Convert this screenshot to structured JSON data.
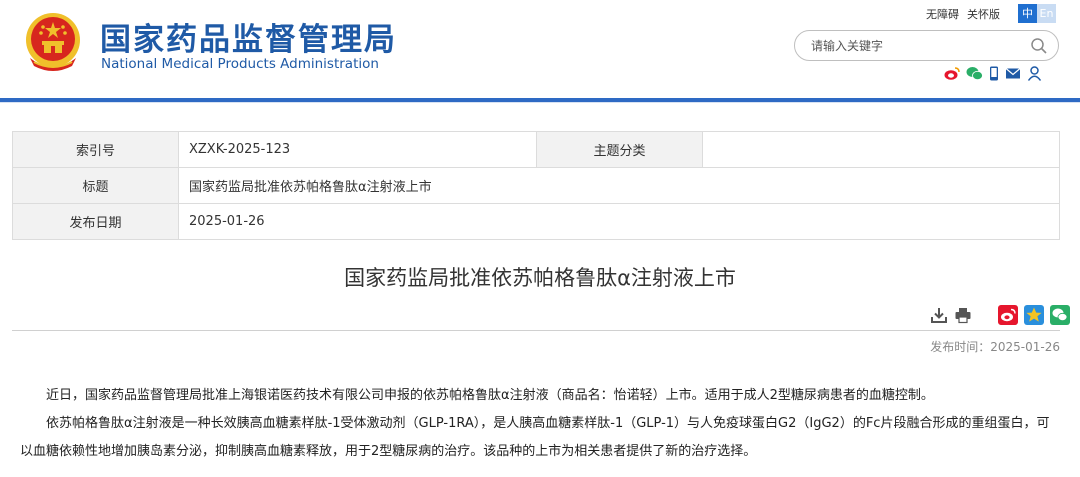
{
  "header": {
    "org_name_cn": "国家药品监督管理局",
    "org_name_en": "National Medical Products Administration",
    "links": [
      "无障碍",
      "关怀版"
    ],
    "lang_zh": "中",
    "lang_en": "En",
    "search": {
      "placeholder": "请输入关键字"
    },
    "social_icons": [
      "weibo-icon",
      "wechat-icon",
      "mobile-icon",
      "mail-icon",
      "user-icon"
    ]
  },
  "info_table": {
    "index_label": "索引号",
    "index_value": "XZXK-2025-123",
    "category_label": "主题分类",
    "category_value": "",
    "title_label": "标题",
    "title_value": "国家药监局批准依苏帕格鲁肽α注射液上市",
    "date_label": "发布日期",
    "date_value": "2025-01-26"
  },
  "article": {
    "title": "国家药监局批准依苏帕格鲁肽α注射液上市",
    "publish_label": "发布时间：2025-01-26",
    "tools": [
      "download-icon",
      "print-icon",
      "share-weibo-icon",
      "share-qzone-icon",
      "share-wechat-icon"
    ],
    "paragraphs": [
      "近日，国家药品监督管理局批准上海银诺医药技术有限公司申报的依苏帕格鲁肽α注射液（商品名：怡诺轻）上市。适用于成人2型糖尿病患者的血糖控制。",
      "依苏帕格鲁肽α注射液是一种长效胰高血糖素样肽-1受体激动剂（GLP-1RA），是人胰高血糖素样肽-1（GLP-1）与人免疫球蛋白G2（IgG2）的Fc片段融合形成的重组蛋白，可以血糖依赖性地增加胰岛素分泌，抑制胰高血糖素释放，用于2型糖尿病的治疗。该品种的上市为相关患者提供了新的治疗选择。"
    ]
  },
  "colors": {
    "brand_blue": "#1f5aa6",
    "rule_blue": "#2e6ac4",
    "emblem_red": "#d7261e",
    "emblem_gold": "#f0c02b"
  }
}
